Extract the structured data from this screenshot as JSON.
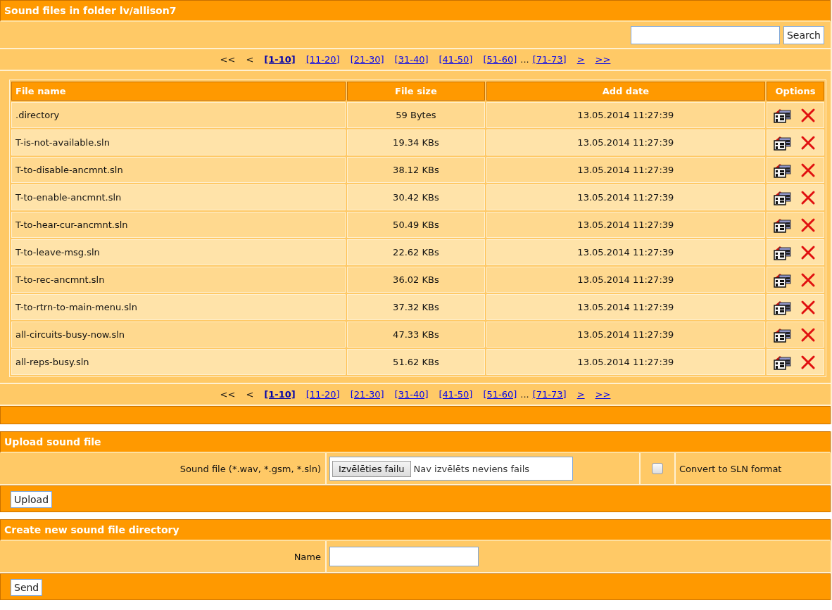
{
  "files_section": {
    "title": "Sound files in folder lv/allison7",
    "search": {
      "button": "Search"
    },
    "pager_top": [
      {
        "kind": "nav",
        "label": "<<",
        "disabled": true
      },
      {
        "kind": "nav",
        "label": "<",
        "disabled": true
      },
      {
        "kind": "page",
        "label": "[1-10]",
        "selected": true
      },
      {
        "kind": "page",
        "label": "[11-20]",
        "selected": false
      },
      {
        "kind": "page",
        "label": "[21-30]",
        "selected": false
      },
      {
        "kind": "page",
        "label": "[31-40]",
        "selected": false
      },
      {
        "kind": "page",
        "label": "[41-50]",
        "selected": false
      },
      {
        "kind": "page",
        "label": "[51-60]",
        "selected": false
      },
      {
        "kind": "gap",
        "label": "..."
      },
      {
        "kind": "page",
        "label": "[71-73]",
        "selected": false
      },
      {
        "kind": "nav",
        "label": ">",
        "disabled": false
      },
      {
        "kind": "nav",
        "label": ">>",
        "disabled": false
      }
    ],
    "table": {
      "columns": [
        "File name",
        "File size",
        "Add date",
        "Options"
      ],
      "rows": [
        {
          "name": ".directory",
          "size": "59 Bytes",
          "date": "13.05.2014 11:27:39"
        },
        {
          "name": "T-is-not-available.sln",
          "size": "19.34 KBs",
          "date": "13.05.2014 11:27:39"
        },
        {
          "name": "T-to-disable-ancmnt.sln",
          "size": "38.12 KBs",
          "date": "13.05.2014 11:27:39"
        },
        {
          "name": "T-to-enable-ancmnt.sln",
          "size": "30.42 KBs",
          "date": "13.05.2014 11:27:39"
        },
        {
          "name": "T-to-hear-cur-ancmnt.sln",
          "size": "50.49 KBs",
          "date": "13.05.2014 11:27:39"
        },
        {
          "name": "T-to-leave-msg.sln",
          "size": "22.62 KBs",
          "date": "13.05.2014 11:27:39"
        },
        {
          "name": "T-to-rec-ancmnt.sln",
          "size": "36.02 KBs",
          "date": "13.05.2014 11:27:39"
        },
        {
          "name": "T-to-rtrn-to-main-menu.sln",
          "size": "37.32 KBs",
          "date": "13.05.2014 11:27:39"
        },
        {
          "name": "all-circuits-busy-now.sln",
          "size": "47.33 KBs",
          "date": "13.05.2014 11:27:39"
        },
        {
          "name": "all-reps-busy.sln",
          "size": "51.62 KBs",
          "date": "13.05.2014 11:27:39"
        }
      ]
    },
    "pager_bottom": [
      {
        "kind": "nav",
        "label": "<<",
        "disabled": true
      },
      {
        "kind": "nav",
        "label": "<",
        "disabled": true
      },
      {
        "kind": "page",
        "label": "[1-10]",
        "selected": true
      },
      {
        "kind": "page",
        "label": "[11-20]",
        "selected": false
      },
      {
        "kind": "page",
        "label": "[21-30]",
        "selected": false
      },
      {
        "kind": "page",
        "label": "[31-40]",
        "selected": false
      },
      {
        "kind": "page",
        "label": "[41-50]",
        "selected": false
      },
      {
        "kind": "page",
        "label": "[51-60]",
        "selected": false
      },
      {
        "kind": "gap",
        "label": "..."
      },
      {
        "kind": "page",
        "label": "[71-73]",
        "selected": false
      },
      {
        "kind": "nav",
        "label": ">",
        "disabled": false
      },
      {
        "kind": "nav",
        "label": ">>",
        "disabled": false
      }
    ]
  },
  "upload_section": {
    "title": "Upload sound file",
    "label": "Sound file (*.wav, *.gsm, *.sln)",
    "choose_button": "Izvēlēties failu",
    "file_status": "Nav izvēlēts neviens fails",
    "convert": {
      "label": "Convert to SLN format",
      "checked": false
    },
    "button": "Upload"
  },
  "directory_section": {
    "title": "Create new sound file directory",
    "label": "Name",
    "button": "Send"
  }
}
